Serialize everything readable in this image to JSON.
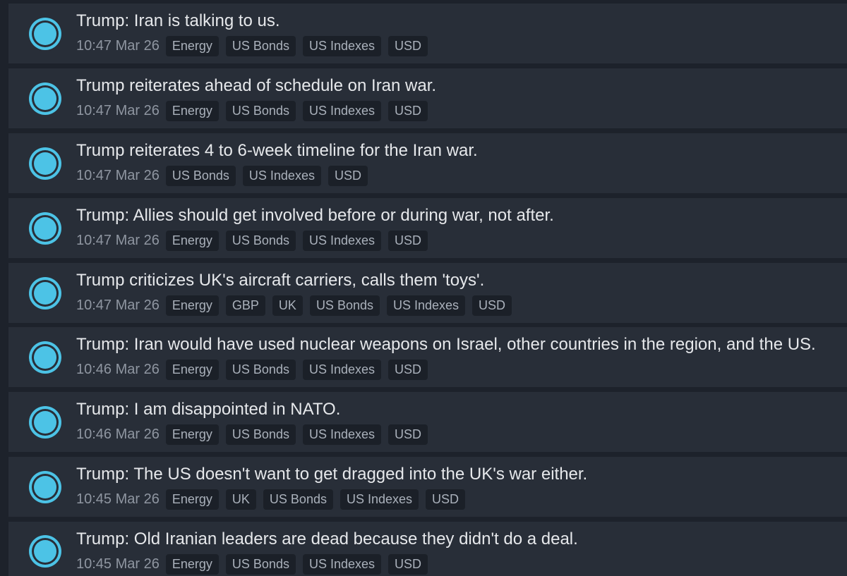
{
  "colors": {
    "page_bg": "#1d222b",
    "row_bg": "#282e38",
    "tag_bg": "#1b2028",
    "headline": "#e6e8eb",
    "time": "#8f96a1",
    "tag_text": "#aab1bb",
    "status_dot": "#4cc3e6"
  },
  "status_icon": "live-dot-icon",
  "news": [
    {
      "headline": "Trump: Iran is talking to us.",
      "time": "10:47 Mar 26",
      "tags": [
        "Energy",
        "US Bonds",
        "US Indexes",
        "USD"
      ]
    },
    {
      "headline": "Trump reiterates ahead of schedule on Iran war.",
      "time": "10:47 Mar 26",
      "tags": [
        "Energy",
        "US Bonds",
        "US Indexes",
        "USD"
      ]
    },
    {
      "headline": "Trump reiterates 4 to 6-week timeline for the Iran war.",
      "time": "10:47 Mar 26",
      "tags": [
        "US Bonds",
        "US Indexes",
        "USD"
      ]
    },
    {
      "headline": "Trump: Allies should get involved before or during war, not after.",
      "time": "10:47 Mar 26",
      "tags": [
        "Energy",
        "US Bonds",
        "US Indexes",
        "USD"
      ]
    },
    {
      "headline": "Trump criticizes UK's aircraft carriers, calls them 'toys'.",
      "time": "10:47 Mar 26",
      "tags": [
        "Energy",
        "GBP",
        "UK",
        "US Bonds",
        "US Indexes",
        "USD"
      ]
    },
    {
      "headline": "Trump: Iran would have used nuclear weapons on Israel, other countries in the region, and the US.",
      "time": "10:46 Mar 26",
      "tags": [
        "Energy",
        "US Bonds",
        "US Indexes",
        "USD"
      ]
    },
    {
      "headline": "Trump: I am disappointed in NATO.",
      "time": "10:46 Mar 26",
      "tags": [
        "Energy",
        "US Bonds",
        "US Indexes",
        "USD"
      ]
    },
    {
      "headline": "Trump: The US doesn't want to get dragged into the UK's war either.",
      "time": "10:45 Mar 26",
      "tags": [
        "Energy",
        "UK",
        "US Bonds",
        "US Indexes",
        "USD"
      ]
    },
    {
      "headline": "Trump: Old Iranian leaders are dead because they didn't do a deal.",
      "time": "10:45 Mar 26",
      "tags": [
        "Energy",
        "US Bonds",
        "US Indexes",
        "USD"
      ]
    }
  ]
}
